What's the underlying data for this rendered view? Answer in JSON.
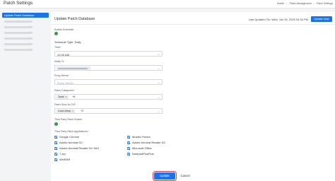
{
  "topbar": {
    "title": "Patch Settings",
    "breadcrumbs": [
      "Admin",
      "Patch Management",
      "Patch Settings"
    ]
  },
  "sidebar": {
    "active_item": "Update Patch Database"
  },
  "panel": {
    "title": "Update Patch Database",
    "last_updated": "Last Updated On: Wed, Jun 25, 2025 03:34 PM",
    "update_now_label": "Update Now"
  },
  "form": {
    "enable_scheduler_label": "Enable Scheduler",
    "schedule_type_label": "Schedule Type: Daily",
    "time_label": "Time*",
    "time_value": "12:00 AM",
    "notify_to_label": "Notify To",
    "proxy_server_label": "Proxy Server",
    "proxy_server_placeholder": "Proxy Server",
    "patch_categories_label": "Patch Categories*",
    "patch_categories_chip": "Tools",
    "patch_categories_more": "+8",
    "patch_sync_os_label": "Patch Sync for OS*",
    "patch_sync_os_chip": "Linux Alma",
    "patch_sync_os_more": "+2",
    "third_party_enable_label": "Third Party Patch Enable",
    "third_party_apps_label": "Third Party Patch Applications*"
  },
  "apps": [
    "Google Chrome",
    "Mozilla Firefox",
    "Adobe Acrobat DC",
    "Adobe Acrobat Reader DC",
    "Adobe Acrobat Reader DC MUI",
    "Microsoft Office",
    "7-zip",
    "NotepadPlusPlus",
    "WinRAR"
  ],
  "footer": {
    "update_label": "Update",
    "cancel_label": "Cancel"
  },
  "colors": {
    "accent": "#1a73e8",
    "toggle_on": "#34a853",
    "highlight": "#e53935"
  }
}
